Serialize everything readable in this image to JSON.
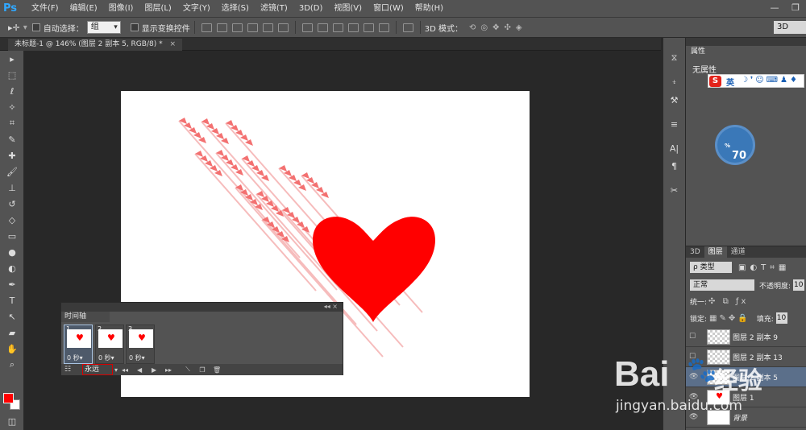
{
  "app": {
    "logo": "Ps"
  },
  "menu": [
    "文件(F)",
    "编辑(E)",
    "图像(I)",
    "图层(L)",
    "文字(Y)",
    "选择(S)",
    "滤镜(T)",
    "3D(D)",
    "视图(V)",
    "窗口(W)",
    "帮助(H)"
  ],
  "window_controls": {
    "minimize": "—",
    "restore": "❐"
  },
  "options": {
    "auto_select_label": "自动选择：",
    "auto_select_value": "组",
    "show_transform_label": "显示变换控件",
    "mode_3d_label": "3D 模式：",
    "workspace": "3D"
  },
  "document": {
    "tab_title": "未标题-1 @ 146% (图层 2 副本 5, RGB/8) *",
    "close": "×"
  },
  "timeline": {
    "title": "时间轴",
    "frames": [
      {
        "num": "1",
        "delay": "0 秒▾"
      },
      {
        "num": "2",
        "delay": "0 秒▾"
      },
      {
        "num": "3",
        "delay": "0 秒▾"
      }
    ],
    "loop": "永远"
  },
  "properties": {
    "tab": "属性",
    "empty": "无属性"
  },
  "ime": {
    "logo": "S",
    "lang": "英"
  },
  "gauge": {
    "value": "70",
    "unit": "%"
  },
  "layers": {
    "tabs": [
      "3D",
      "图层",
      "通道"
    ],
    "filter_label": "ρ 类型",
    "blend_mode": "正常",
    "opacity_label": "不透明度:",
    "opacity_value": "10",
    "unify_label": "统一:",
    "lock_label": "锁定:",
    "fill_label": "填充:",
    "fill_value": "10",
    "items": [
      {
        "name": "图层 2 副本 9"
      },
      {
        "name": "图层 2 副本 13"
      },
      {
        "name": "图层 2 副本 5"
      },
      {
        "name": "图层 1"
      },
      {
        "name": "背景"
      }
    ]
  },
  "watermark": {
    "brand": "Bai",
    "brand2": "经验",
    "url": "jingyan.baidu.com"
  }
}
